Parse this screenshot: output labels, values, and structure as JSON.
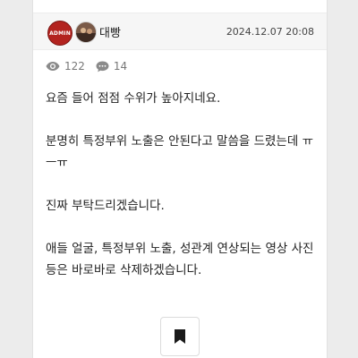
{
  "post": {
    "admin_badge": "ADMIN",
    "author": "대빵",
    "date": "2024.12.07 20:08",
    "views": "122",
    "comments": "14",
    "paragraphs": [
      "요즘 들어 점점 수위가 높아지네요.",
      "분명히 특정부위 노출은 안된다고 말씀을 드렸는데 ㅠㅡㅠ",
      "진짜 부탁드리겠습니다.",
      "애들 얼굴, 특정부위 노출, 성관계 연상되는 영상 사진 등은 바로바로 삭제하겠습니다."
    ]
  },
  "icons": {
    "views": "eye-icon",
    "comments": "comment-icon",
    "bookmark": "bookmark-icon"
  }
}
